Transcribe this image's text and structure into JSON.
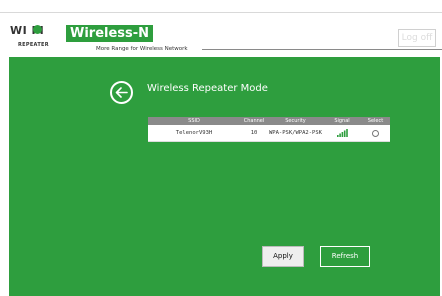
{
  "header": {
    "logo_text": "WI FI",
    "logo_sub": "REPEATER",
    "brand": "Wireless-N",
    "tagline": "More Range for Wireless Network",
    "logoff_label": "Log off"
  },
  "colors": {
    "brand_green": "#2e9e3e",
    "table_header_gray": "#8a8a8a"
  },
  "page": {
    "title": "Wireless Repeater Mode",
    "back_icon": "arrow-left-circle-icon"
  },
  "table": {
    "columns": [
      "SSID",
      "Channel",
      "Security",
      "Signal",
      "Select"
    ],
    "rows": [
      {
        "ssid": "TelenorV93H",
        "channel": "10",
        "security": "WPA-PSK/WPA2-PSK",
        "signal_icon": "signal-bars-icon",
        "selected": false
      }
    ]
  },
  "buttons": {
    "apply_label": "Apply",
    "refresh_label": "Refresh"
  }
}
